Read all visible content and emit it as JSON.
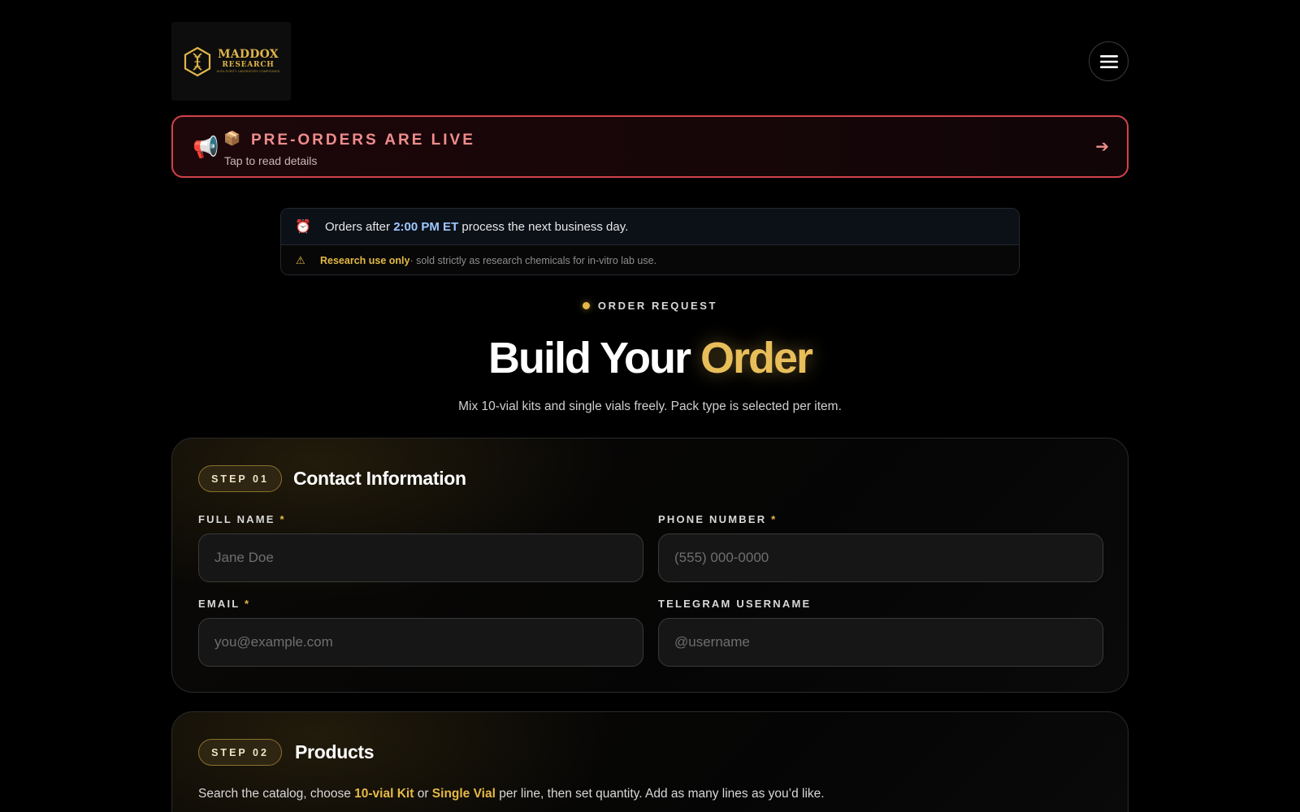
{
  "header": {
    "logo": {
      "line1": "MADDOX",
      "line2": "RESEARCH",
      "tagline": "HIGH-PURITY LABORATORY COMPOUNDS"
    },
    "menu_icon": "hamburger-menu-icon"
  },
  "announcement": {
    "megaphone_icon": "📢",
    "package_icon": "📦",
    "title": "PRE-ORDERS ARE LIVE",
    "subtitle": "Tap to read details",
    "arrow": "➔"
  },
  "notice": {
    "clock_icon": "⏰",
    "prefix": "Orders after",
    "time": "2:00 PM ET",
    "suffix": "process the next business day.",
    "warning_icon": "⚠",
    "ruo_label": "Research use only",
    "ruo_text": " · sold strictly as research chemicals for in-vitro lab use."
  },
  "hero": {
    "eyebrow": "ORDER REQUEST",
    "title_main": "Build Your ",
    "title_accent": "Order",
    "subtitle": "Mix 10-vial kits and single vials freely. Pack type is selected per item."
  },
  "step1": {
    "step": "STEP 01",
    "title": "Contact Information",
    "fields": [
      {
        "label": "FULL NAME",
        "required": "*",
        "placeholder": "Jane Doe",
        "value": ""
      },
      {
        "label": "PHONE NUMBER",
        "required": "*",
        "placeholder": "(555) 000-0000",
        "value": ""
      },
      {
        "label": "EMAIL",
        "required": "*",
        "placeholder": "you@example.com",
        "value": ""
      },
      {
        "label": "TELEGRAM USERNAME",
        "required": "",
        "placeholder": "@username",
        "value": ""
      }
    ]
  },
  "step2": {
    "step": "STEP 02",
    "title": "Products",
    "desc_1": "Search the catalog, choose ",
    "kit": "10-vial Kit",
    "desc_2": " or ",
    "single": "Single Vial",
    "desc_3": " per line, then set quantity. Add as many lines as you’d like."
  },
  "colors": {
    "accent_gold": "#e5b946",
    "alert_red": "#d0434b",
    "time_blue": "#9fc7ff",
    "background": "#000000"
  }
}
